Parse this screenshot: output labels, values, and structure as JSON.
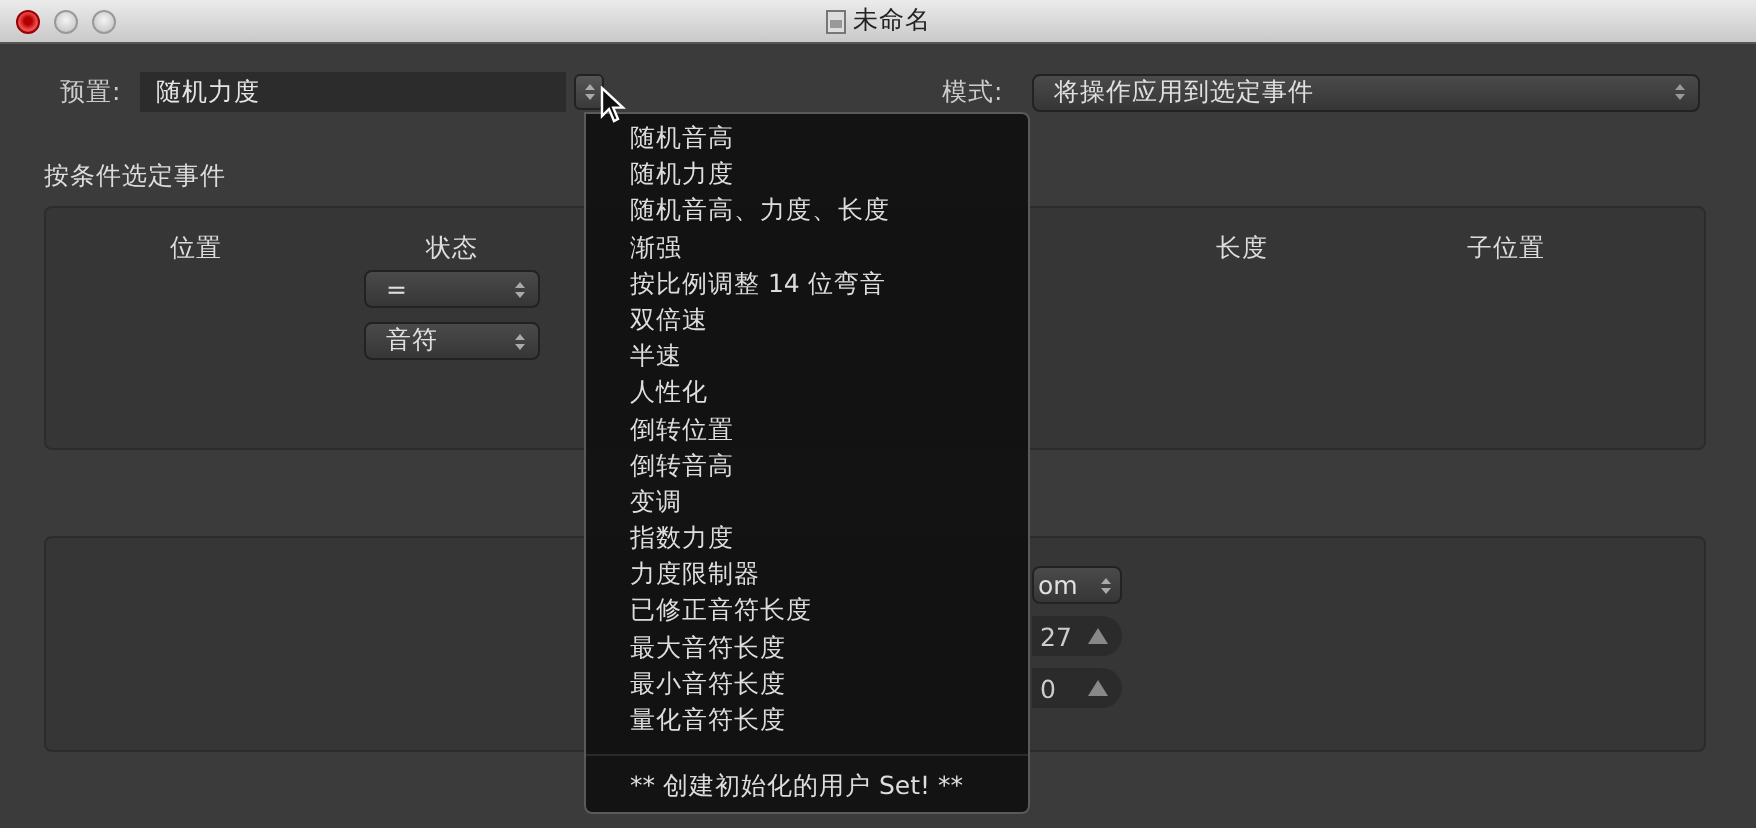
{
  "window": {
    "title": "未命名"
  },
  "preset": {
    "label": "预置:",
    "value": "随机力度"
  },
  "mode": {
    "label": "模式:",
    "value": "将操作应用到选定事件"
  },
  "select_section": {
    "title": "按条件选定事件",
    "columns": [
      "位置",
      "状态",
      "长度",
      "子位置"
    ],
    "status_popups": [
      "=",
      "音符"
    ]
  },
  "operation_section": {
    "popup": "om",
    "steppers": [
      "27",
      "0"
    ]
  },
  "preset_menu": {
    "items": [
      {
        "label": "随机音高"
      },
      {
        "label": "随机力度"
      },
      {
        "label": "随机音高、力度、长度"
      },
      {
        "label": "渐强"
      },
      {
        "label": "按比例调整 14 位弯音"
      },
      {
        "label": "双倍速"
      },
      {
        "label": "半速"
      },
      {
        "label": "人性化"
      },
      {
        "label": "倒转位置"
      },
      {
        "label": "倒转音高"
      },
      {
        "label": "变调"
      },
      {
        "label": "指数力度"
      },
      {
        "label": "力度限制器"
      },
      {
        "label": "已修正音符长度"
      },
      {
        "label": "最大音符长度"
      },
      {
        "label": "最小音符长度"
      },
      {
        "label": "量化音符长度"
      }
    ],
    "footer": "** 创建初始化的用户 Set! **"
  }
}
